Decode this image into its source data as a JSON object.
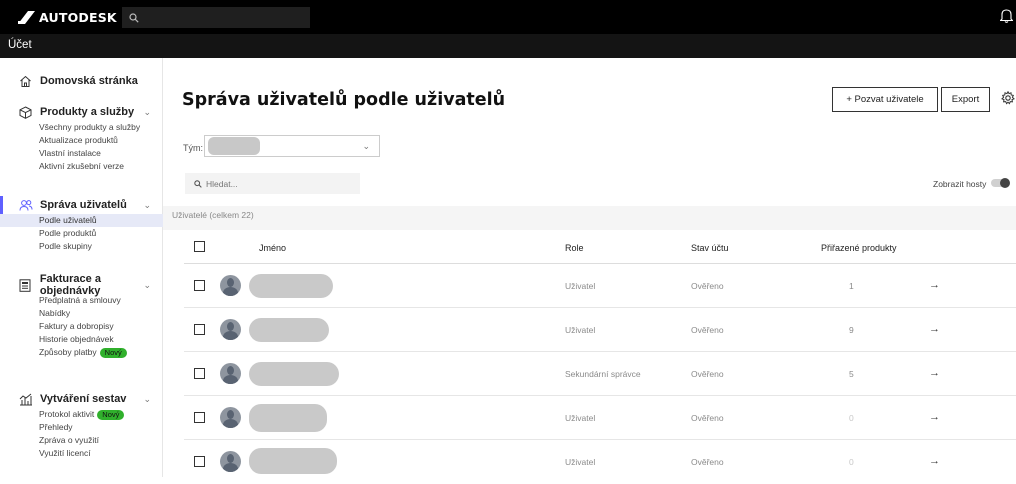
{
  "header": {
    "brand": "AUTODESK",
    "section_title": "Účet",
    "icons": {
      "search": "search-icon",
      "notifications": "bell-icon"
    }
  },
  "sidebar": {
    "groups": [
      {
        "label": "Domovská stránka",
        "icon": "home-icon",
        "items": []
      },
      {
        "label": "Produkty a služby",
        "icon": "cube-icon",
        "items": [
          "Všechny produkty a služby",
          "Aktualizace produktů",
          "Vlastní instalace",
          "Aktivní zkušební verze"
        ]
      },
      {
        "label": "Správa uživatelů",
        "icon": "users-icon",
        "items": [
          "Podle uživatelů",
          "Podle produktů",
          "Podle skupiny"
        ],
        "active_item": "Podle uživatelů"
      },
      {
        "label": "Fakturace a objednávky",
        "icon": "billing-icon",
        "items": [
          "Předplatná a smlouvy",
          "Nabídky",
          "Faktury a dobropisy",
          "Historie objednávek",
          "Způsoby platby"
        ],
        "badges": {
          "Způsoby platby": "Nový"
        }
      },
      {
        "label": "Vytváření sestav",
        "icon": "reports-icon",
        "items": [
          "Protokol aktivit",
          "Přehledy",
          "Zpráva o využití",
          "Využití licencí"
        ],
        "badges": {
          "Protokol aktivit": "Nový"
        }
      }
    ]
  },
  "main": {
    "title": "Správa uživatelů podle uživatelů",
    "invite_button": "+ Pozvat uživatele",
    "export_button": "Export",
    "team_label": "Tým:",
    "search_placeholder": "Hledat...",
    "show_guests_label": "Zobrazit hosty",
    "users_count": "Uživatelé (celkem 22)",
    "table": {
      "columns": [
        "Jméno",
        "Role",
        "Stav účtu",
        "Přiřazené produkty"
      ],
      "rows": [
        {
          "role": "Uživatel",
          "status": "Ověřeno",
          "products": "1"
        },
        {
          "role": "Uživatel",
          "status": "Ověřeno",
          "products": "9"
        },
        {
          "role": "Sekundární správce",
          "status": "Ověřeno",
          "products": "5"
        },
        {
          "role": "Uživatel",
          "status": "Ověřeno",
          "products": "0"
        },
        {
          "role": "Uživatel",
          "status": "Ověřeno",
          "products": "0"
        }
      ]
    }
  }
}
